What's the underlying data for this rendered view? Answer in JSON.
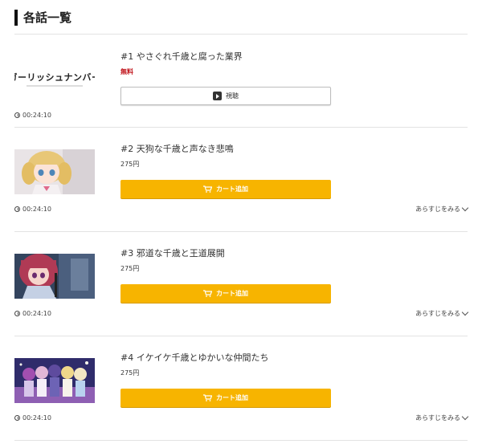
{
  "section": {
    "title": "各話一覧"
  },
  "episodes": [
    {
      "title": "#1 やさぐれ千歳と腐った業界",
      "price": "無料",
      "button": "視聴",
      "duration": "00:24:10",
      "logo_text": "ガーリッシュナンバー"
    },
    {
      "title": "#2 天狗な千歳と声なき悲鳴",
      "price": "275円",
      "button": "カート追加",
      "duration": "00:24:10",
      "synopsis": "あらすじをみる"
    },
    {
      "title": "#3 邪道な千歳と王道展開",
      "price": "275円",
      "button": "カート追加",
      "duration": "00:24:10",
      "synopsis": "あらすじをみる"
    },
    {
      "title": "#4 イケイケ千歳とゆかいな仲間たち",
      "price": "275円",
      "button": "カート追加",
      "duration": "00:24:10",
      "synopsis": "あらすじをみる"
    }
  ],
  "colors": {
    "cart_button": "#f7b400",
    "free_price": "#c0141b"
  }
}
